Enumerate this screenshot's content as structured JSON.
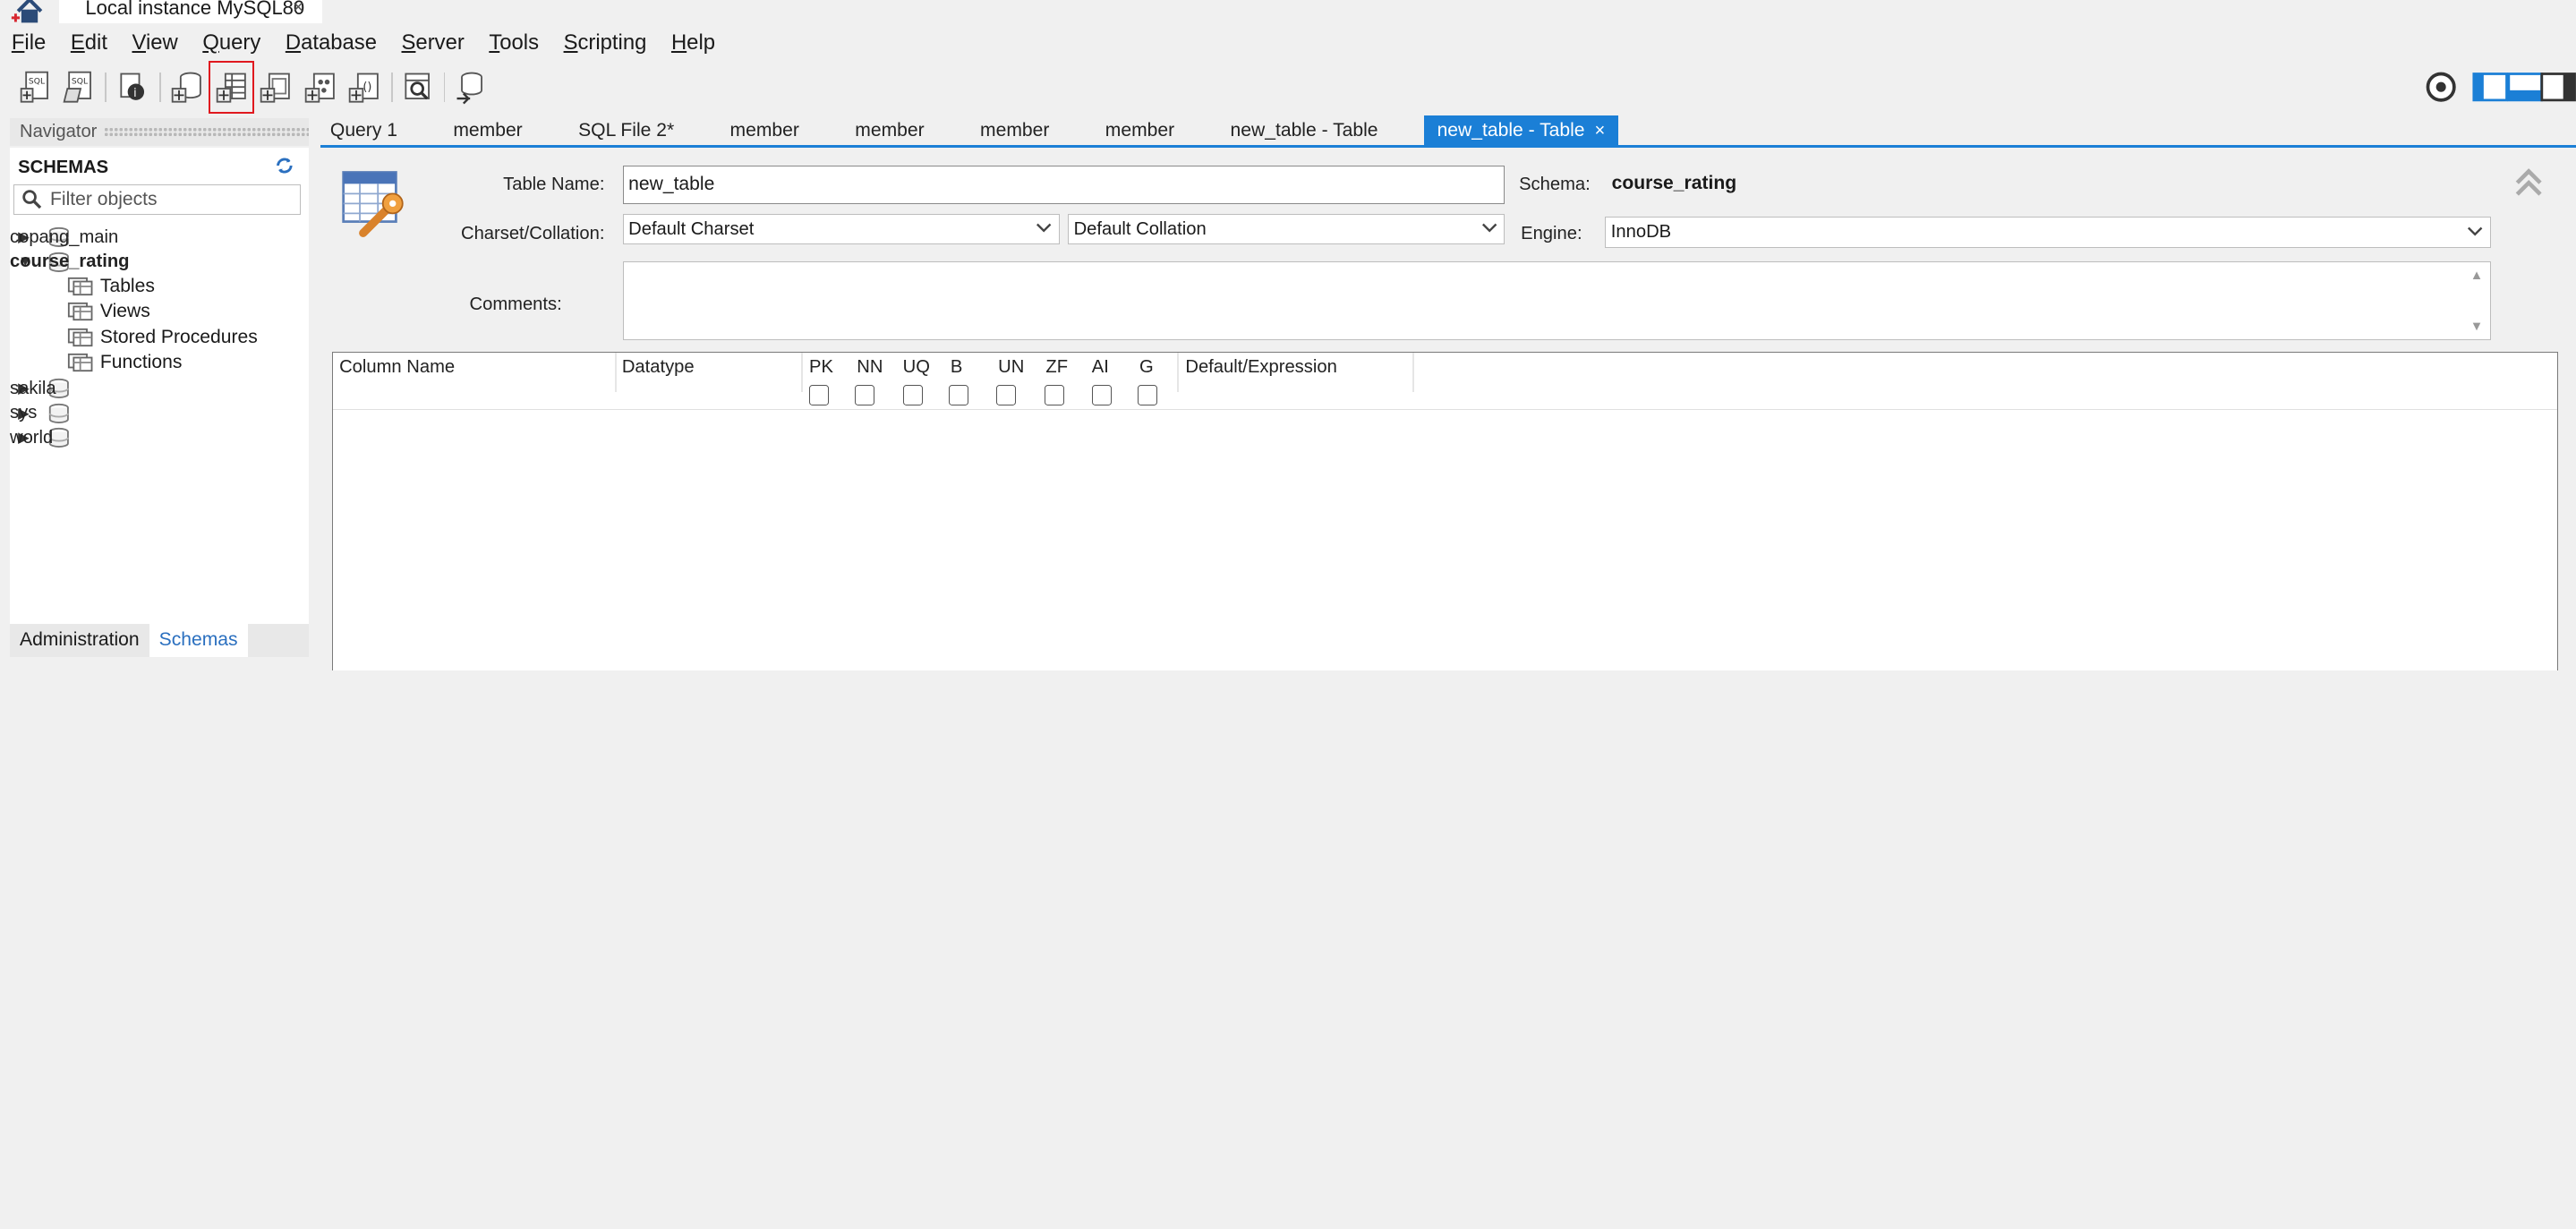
{
  "window": {
    "home_icon": "home-icon",
    "connection_tab": "Local instance MySQL80",
    "connection_tab_close": "×"
  },
  "menu": [
    {
      "accel": "F",
      "rest": "ile"
    },
    {
      "accel": "E",
      "rest": "dit"
    },
    {
      "accel": "V",
      "rest": "iew"
    },
    {
      "accel": "Q",
      "rest": "uery"
    },
    {
      "accel": "D",
      "rest": "atabase"
    },
    {
      "accel": "S",
      "rest": "erver"
    },
    {
      "accel": "T",
      "rest": "ools"
    },
    {
      "accel": "S",
      "rest": "cripting"
    },
    {
      "accel": "H",
      "rest": "elp"
    }
  ],
  "toolbar": {
    "icons": [
      "new-sql-tab-icon",
      "open-sql-script-icon",
      "inspector-icon",
      "create-schema-icon",
      "create-table-icon",
      "create-view-icon",
      "create-procedure-icon",
      "create-function-icon",
      "search-table-data-icon",
      "reconnect-icon"
    ],
    "highlighted": "create-table-icon",
    "right_icons": [
      "settings-icon",
      "toggle-sidebar-icon",
      "toggle-output-icon",
      "toggle-secondary-sidebar-icon"
    ]
  },
  "navigator": {
    "header": "Navigator",
    "schemas_title": "SCHEMAS",
    "filter_placeholder": "Filter objects",
    "tree": {
      "copang_main": "copang_main",
      "course_rating": "course_rating",
      "tables": "Tables",
      "views": "Views",
      "stored_procedures": "Stored Procedures",
      "functions": "Functions",
      "sakila": "sakila",
      "sys": "sys",
      "world": "world"
    },
    "bottom_tabs": {
      "administration": "Administration",
      "schemas": "Schemas"
    }
  },
  "editor_tabs": {
    "t1": "Query 1",
    "t2": "member",
    "t3": "SQL File 2*",
    "t4": "member",
    "t5": "member",
    "t6": "member",
    "t7": "member",
    "t8": "new_table - Table",
    "t9": "new_table - Table",
    "close": "×"
  },
  "table_editor": {
    "table_name_label": "Table Name:",
    "table_name_value": "new_table",
    "schema_label": "Schema:",
    "schema_value": "course_rating",
    "charset_label": "Charset/Collation:",
    "charset_value": "Default Charset",
    "collation_value": "Default Collation",
    "engine_label": "Engine:",
    "engine_value": "InnoDB",
    "comments_label": "Comments:",
    "columns": {
      "column_name": "Column Name",
      "datatype": "Datatype",
      "pk": "PK",
      "nn": "NN",
      "uq": "UQ",
      "b": "B",
      "un": "UN",
      "zf": "ZF",
      "ai": "AI",
      "g": "G",
      "default": "Default/Expression"
    }
  },
  "colors": {
    "accent": "#1b7fd6",
    "highlight_border": "#e0191f"
  }
}
